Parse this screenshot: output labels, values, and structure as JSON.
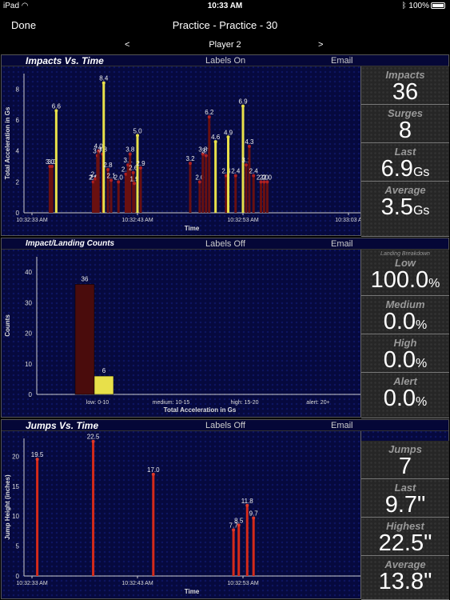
{
  "status": {
    "device": "iPad",
    "time": "10:33 AM",
    "battery": "100%"
  },
  "nav": {
    "done_label": "Done",
    "title": "Practice - Practice - 30"
  },
  "player": {
    "prev": "<",
    "name": "Player 2",
    "next": ">"
  },
  "colors": {
    "impact_dark": "#6a1010",
    "impact_bright": "#e8e04a",
    "jump_bar": "#d42a1a",
    "panel_bg": "#06093e"
  },
  "impacts": {
    "title": "Impacts Vs. Time",
    "labels_toggle": "Labels On",
    "email": "Email",
    "stats": [
      {
        "label": "Impacts",
        "value": "36",
        "unit": ""
      },
      {
        "label": "Surges",
        "value": "8",
        "unit": ""
      },
      {
        "label": "Last",
        "value": "6.9",
        "unit": "Gs"
      },
      {
        "label": "Average",
        "value": "3.5",
        "unit": "Gs"
      }
    ]
  },
  "counts": {
    "title": "Impact/Landing Counts",
    "labels_toggle": "Labels Off",
    "email": "Email",
    "breakdown_label": "Landing Breakdown",
    "stats": [
      {
        "label": "Low",
        "value": "100.0",
        "unit": "%"
      },
      {
        "label": "Medium",
        "value": "0.0",
        "unit": "%"
      },
      {
        "label": "High",
        "value": "0.0",
        "unit": "%"
      },
      {
        "label": "Alert",
        "value": "0.0",
        "unit": "%"
      }
    ]
  },
  "jumps": {
    "title": "Jumps Vs. Time",
    "labels_toggle": "Labels Off",
    "email": "Email",
    "stats": [
      {
        "label": "Jumps",
        "value": "7",
        "unit": ""
      },
      {
        "label": "Last",
        "value": "9.7\"",
        "unit": ""
      },
      {
        "label": "Highest",
        "value": "22.5\"",
        "unit": ""
      },
      {
        "label": "Average",
        "value": "13.8\"",
        "unit": ""
      }
    ]
  },
  "chart_data": [
    {
      "type": "bar",
      "ylabel": "Total Acceleration in Gs",
      "xlabel": "Time",
      "ylim": [
        0,
        9
      ],
      "yticks": [
        0,
        2,
        4,
        6,
        8
      ],
      "xticks": [
        "10:32:33 AM",
        "10:32:43 AM",
        "10:32:53 AM",
        "10:33:03 A"
      ],
      "xlim_seconds": [
        0,
        30
      ],
      "series": [
        {
          "x": [
            1.7,
            1.9,
            2.3,
            5.8,
            5.9,
            6.0,
            6.2,
            6.3,
            6.7,
            6.8,
            7.2,
            7.5,
            8.2,
            8.9,
            9.1,
            9.3,
            9.6,
            9.7,
            10.0,
            10.3,
            15.0,
            15.9,
            16.2,
            16.5,
            16.8,
            17.4,
            18.4,
            18.6,
            19.3,
            20.0,
            20.3,
            20.6,
            21.0,
            21.7,
            22.0,
            22.3
          ],
          "values": [
            3.0,
            3.0,
            6.6,
            2.0,
            2.0,
            2.2,
            3.7,
            4.0,
            3.8,
            8.4,
            2.8,
            2.1,
            2.0,
            2.5,
            3.1,
            3.8,
            2.6,
            1.9,
            5.0,
            2.9,
            3.2,
            2.0,
            3.8,
            3.7,
            6.2,
            4.6,
            2.4,
            4.9,
            2.4,
            6.9,
            3.1,
            4.3,
            2.4,
            2.0,
            2.0,
            2.0
          ],
          "labels": [
            "3.0",
            "3.0",
            "6.6",
            "2.0",
            "2.0",
            "2.2",
            "3.7",
            "4.0",
            "3.8",
            "8.4",
            "2.8",
            "2.1",
            "2.0",
            "2.5",
            "3.1",
            "3.8",
            "2.6",
            "1.9",
            "5.0",
            "2.9",
            "3.2",
            "2.0",
            "3.8",
            "3.7",
            "6.2",
            "4.6",
            "2.4",
            "4.9",
            "2.4",
            "6.9",
            "3.1",
            "4.3",
            "2.4",
            "2.0",
            "2.0",
            "2.0"
          ],
          "bright": [
            false,
            false,
            true,
            false,
            false,
            false,
            false,
            false,
            false,
            true,
            false,
            false,
            false,
            false,
            false,
            false,
            false,
            false,
            true,
            false,
            false,
            false,
            false,
            false,
            false,
            true,
            false,
            true,
            false,
            true,
            false,
            false,
            false,
            false,
            false,
            false
          ]
        }
      ]
    },
    {
      "type": "bar",
      "ylabel": "Counts",
      "xlabel": "Total Acceleration in Gs",
      "ylim": [
        0,
        45
      ],
      "yticks": [
        0,
        10,
        20,
        30,
        40
      ],
      "categories": [
        "low: 0-10",
        "medium: 10-15",
        "high: 15-20",
        "alert: 20+"
      ],
      "series": [
        {
          "name": "impacts",
          "values": [
            36,
            0,
            0,
            0
          ]
        },
        {
          "name": "landings",
          "values": [
            6,
            0,
            0,
            0
          ]
        }
      ]
    },
    {
      "type": "bar",
      "ylabel": "Jump Height (inches)",
      "xlabel": "Time",
      "ylim": [
        0,
        23
      ],
      "yticks": [
        0,
        5,
        10,
        15,
        20
      ],
      "xticks": [
        "10:32:33 AM",
        "10:32:43 AM",
        "10:32:53 AM"
      ],
      "xlim_seconds": [
        0,
        30
      ],
      "series": [
        {
          "x": [
            0.5,
            5.8,
            11.5,
            19.1,
            19.6,
            20.4,
            21.0
          ],
          "values": [
            19.5,
            22.5,
            17.0,
            7.7,
            8.5,
            11.8,
            9.7
          ],
          "labels": [
            "19.5",
            "22.5",
            "17.0",
            "7.7",
            "8.5",
            "11.8",
            "9.7"
          ]
        }
      ]
    }
  ]
}
